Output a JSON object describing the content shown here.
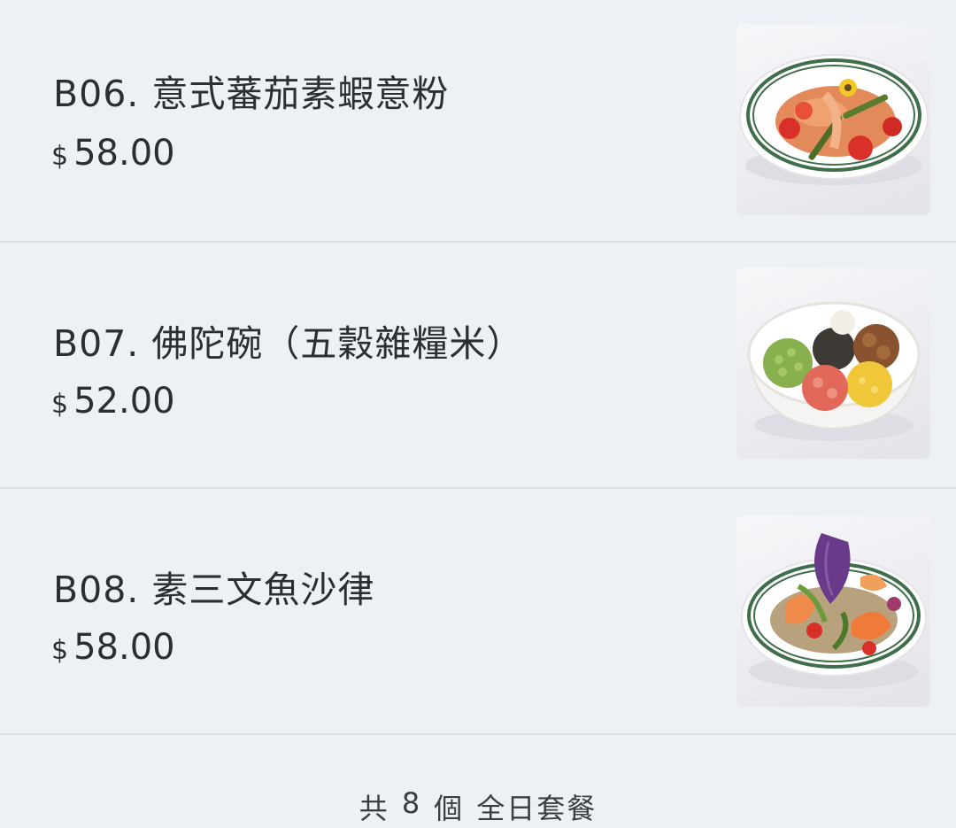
{
  "menu": {
    "items": [
      {
        "name": "B06. 意式蕃茄素蝦意粉",
        "currency": "$",
        "price": "58.00",
        "photo_icon": "pasta-plate-icon"
      },
      {
        "name": "B07. 佛陀碗（五穀雜糧米）",
        "currency": "$",
        "price": "52.00",
        "photo_icon": "buddha-bowl-icon"
      },
      {
        "name": "B08. 素三文魚沙律",
        "currency": "$",
        "price": "58.00",
        "photo_icon": "salmon-salad-icon"
      }
    ]
  },
  "footer": {
    "prefix": "共",
    "count": "8",
    "unit": "個",
    "category": "全日套餐"
  }
}
